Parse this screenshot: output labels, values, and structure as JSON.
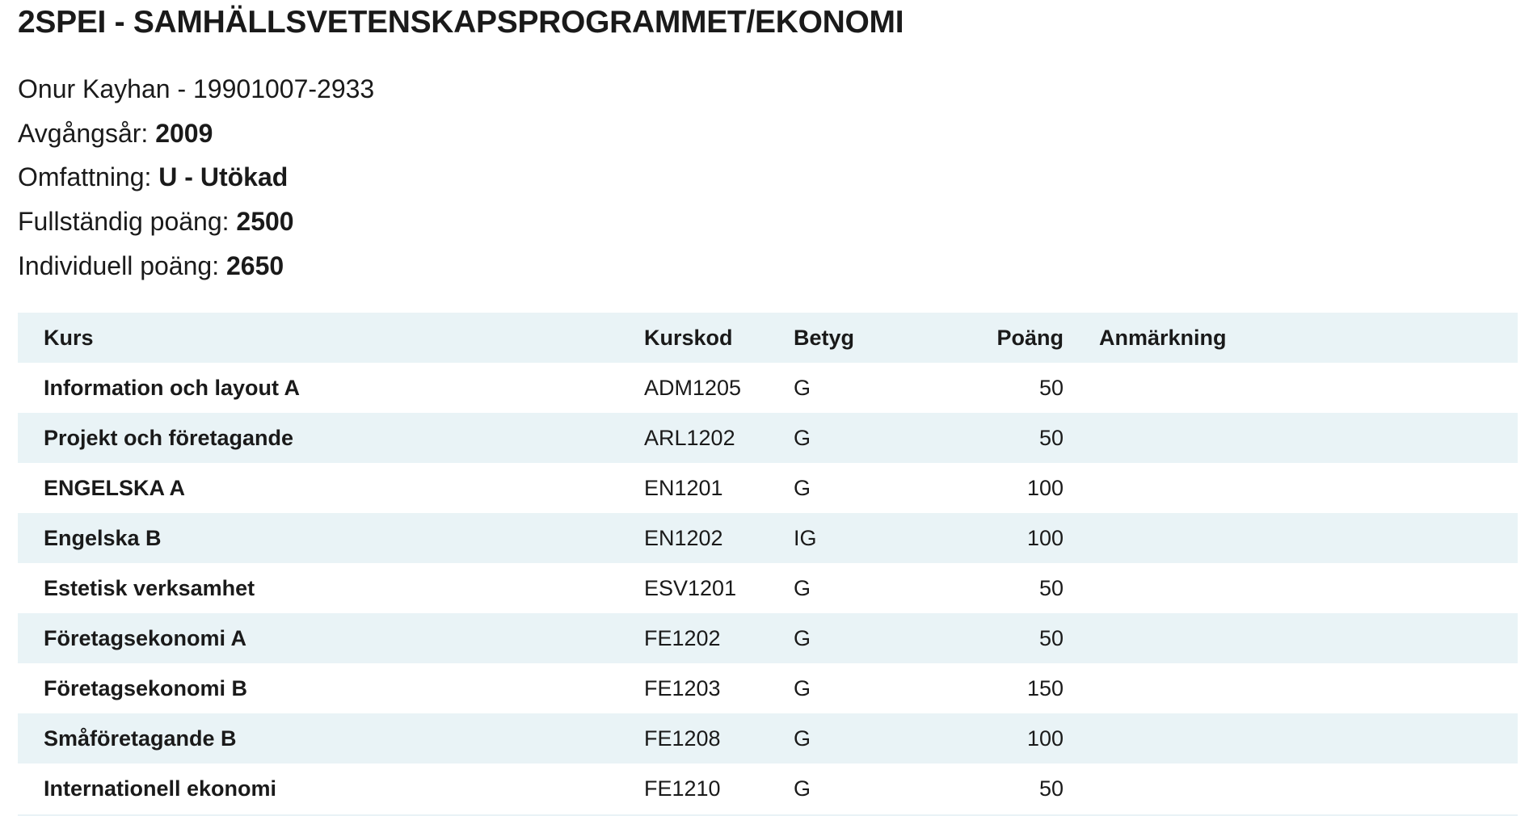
{
  "header": {
    "title": "2SPEI - SAMHÄLLSVETENSKAPSPROGRAMMET/EKONOMI"
  },
  "student": {
    "name_line": "Onur Kayhan - 19901007-2933",
    "graduation_label": "Avgångsår:",
    "graduation_value": "2009",
    "scope_label": "Omfattning:",
    "scope_value": "U - Utökad",
    "full_points_label": "Fullständig poäng:",
    "full_points_value": "2500",
    "individual_points_label": "Individuell poäng:",
    "individual_points_value": "2650"
  },
  "table": {
    "columns": {
      "course": "Kurs",
      "code": "Kurskod",
      "grade": "Betyg",
      "points": "Poäng",
      "remark": "Anmärkning"
    },
    "rows": [
      {
        "course": "Information och layout A",
        "code": "ADM1205",
        "grade": "G",
        "points": "50",
        "remark": ""
      },
      {
        "course": "Projekt och företagande",
        "code": "ARL1202",
        "grade": "G",
        "points": "50",
        "remark": ""
      },
      {
        "course": "ENGELSKA A",
        "code": "EN1201",
        "grade": "G",
        "points": "100",
        "remark": ""
      },
      {
        "course": "Engelska B",
        "code": "EN1202",
        "grade": "IG",
        "points": "100",
        "remark": ""
      },
      {
        "course": "Estetisk verksamhet",
        "code": "ESV1201",
        "grade": "G",
        "points": "50",
        "remark": ""
      },
      {
        "course": "Företagsekonomi A",
        "code": "FE1202",
        "grade": "G",
        "points": "50",
        "remark": ""
      },
      {
        "course": "Företagsekonomi B",
        "code": "FE1203",
        "grade": "G",
        "points": "150",
        "remark": ""
      },
      {
        "course": "Småföretagande B",
        "code": "FE1208",
        "grade": "G",
        "points": "100",
        "remark": ""
      },
      {
        "course": "Internationell ekonomi",
        "code": "FE1210",
        "grade": "G",
        "points": "50",
        "remark": ""
      }
    ]
  },
  "colors": {
    "row_stripe": "#e9f3f6",
    "text": "#1a1a1a"
  }
}
